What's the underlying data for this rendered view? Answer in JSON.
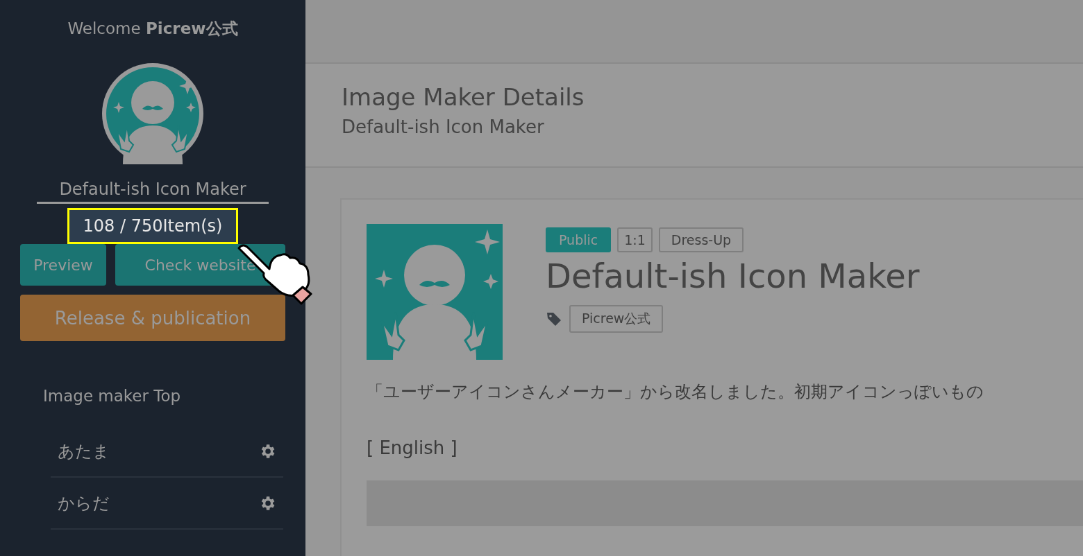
{
  "sidebar": {
    "welcome": "Welcome **Picrew公式**",
    "maker_name": "Default-ish Icon Maker",
    "item_count": {
      "text": "108 / 750Item(s)",
      "highlighted": true
    },
    "buttons": [
      {
        "label": "Preview",
        "kind": "teal"
      },
      {
        "label": "Check website",
        "kind": "teal"
      },
      {
        "label": "Release & publication",
        "kind": "orange"
      }
    ],
    "nav_title": "Image maker Top",
    "parts": [
      {
        "label": "あたま"
      },
      {
        "label": "からだ"
      }
    ]
  },
  "main": {
    "page_title": "Image Maker Details",
    "page_subtitle": "Default-ish Icon Maker",
    "card": {
      "badges": [
        {
          "label": "Public",
          "kind": "filled"
        },
        {
          "label": "1:1",
          "kind": "outline"
        },
        {
          "label": "Dress-Up",
          "kind": "outline"
        }
      ],
      "title": "Default-ish Icon Maker",
      "tags": [
        "Picrew公式"
      ],
      "description": "「ユーザーアイコンさんメーカー」から改名しました。初期アイコンっぽいもの",
      "english_label": "[ English ]"
    }
  }
}
